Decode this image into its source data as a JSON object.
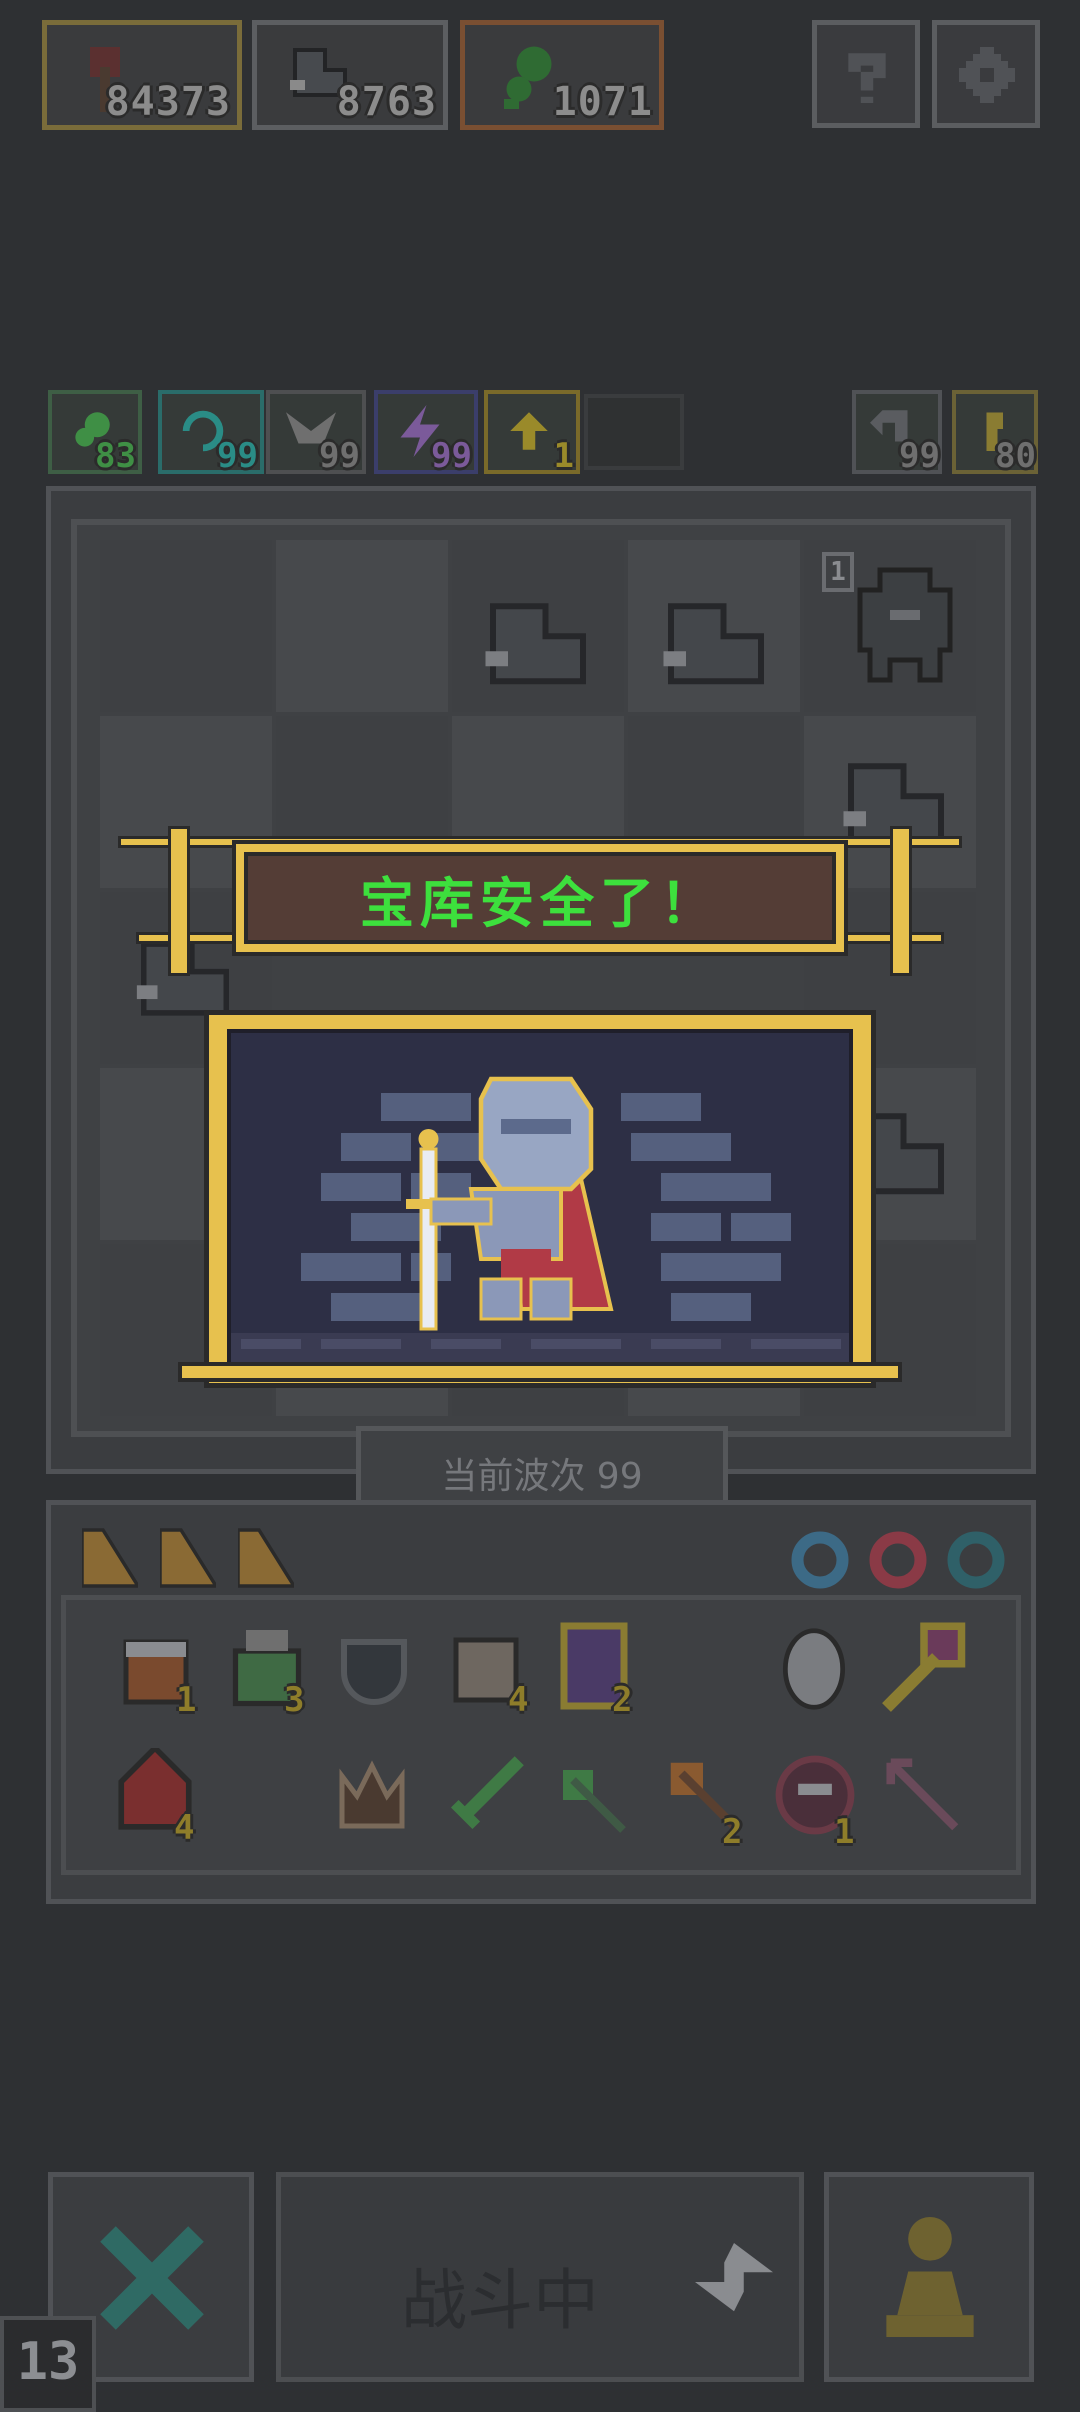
{
  "resources": [
    {
      "name": "axe",
      "value": "84373"
    },
    {
      "name": "sock",
      "value": "8763"
    },
    {
      "name": "pea",
      "value": "1071"
    }
  ],
  "stats": [
    {
      "icon": "pea-icon",
      "value": "83",
      "color": "#3f8f45"
    },
    {
      "icon": "spiral-icon",
      "value": "99",
      "color": "#2a8c86"
    },
    {
      "icon": "wings-icon",
      "value": "99",
      "color": "#6f6f6f"
    },
    {
      "icon": "lightning-icon",
      "value": "99",
      "color": "#7b5a9a"
    },
    {
      "icon": "arrow-up-icon",
      "value": "1",
      "color": "#9a8a2a"
    }
  ],
  "right_stats": [
    {
      "icon": "return-icon",
      "value": "99"
    },
    {
      "icon": "key-icon",
      "value": "80"
    }
  ],
  "grid_badge": "1",
  "banner": {
    "title": "宝库安全了！"
  },
  "wave": {
    "label": "当前波次 99"
  },
  "inventory": [
    {
      "icon": "bucket-icon",
      "count": "1"
    },
    {
      "icon": "goblin-icon",
      "count": "3"
    },
    {
      "icon": "shield-icon",
      "count": ""
    },
    {
      "icon": "scroll-icon",
      "count": "4"
    },
    {
      "icon": "potion-icon",
      "count": "2"
    },
    {
      "icon": "mirror-icon",
      "count": ""
    },
    {
      "icon": "wand-icon",
      "count": ""
    },
    {
      "icon": "demon-icon",
      "count": "4"
    },
    {
      "icon": "crown-icon",
      "count": ""
    },
    {
      "icon": "sword-icon",
      "count": ""
    },
    {
      "icon": "green-axe-icon",
      "count": ""
    },
    {
      "icon": "orange-axe-icon",
      "count": "2"
    },
    {
      "icon": "monster-orb-icon",
      "count": "1"
    },
    {
      "icon": "arrow-icon",
      "count": ""
    }
  ],
  "bottom": {
    "battle_label": "战斗中",
    "corner_number": "13"
  }
}
